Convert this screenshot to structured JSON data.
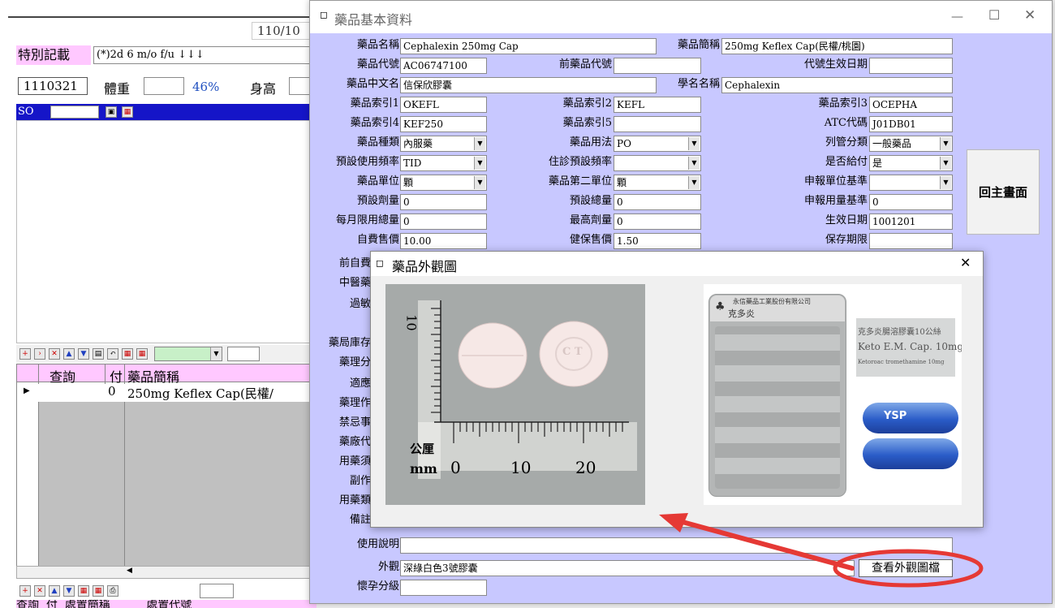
{
  "background_app": {
    "date_text": "110/10",
    "special_note_label": "特別記載",
    "special_note_value": "(*)2d 6 m/o f/u  ↓↓↓",
    "visit_date": "1110321",
    "weight_label": "體重",
    "percent_text": "46%",
    "height_label": "身高",
    "so_label": "SO",
    "grid": {
      "col_query": "查詢",
      "col_pay": "付",
      "col_name": "藥品簡稱",
      "row_pay": "0",
      "row_name": "250mg Keflex Cap(民權/"
    },
    "bottom_header": "查詢  付  處置簡稱          處置代號"
  },
  "drug_dialog": {
    "title": "藥品基本資料",
    "fields": {
      "drug_name_label": "藥品名稱",
      "drug_name": "Cephalexin 250mg Cap",
      "short_name_label": "藥品簡稱",
      "short_name": "250mg Keflex Cap(民權/桃園)",
      "code_label": "藥品代號",
      "code": "AC06747100",
      "prev_code_label": "前藥品代號",
      "prev_code": "",
      "code_date_label": "代號生效日期",
      "code_date": "",
      "chinese_name_label": "藥品中文名",
      "chinese_name": "信保欣膠囊",
      "generic_label": "學名名稱",
      "generic": "Cephalexin",
      "idx1_label": "藥品索引1",
      "idx1": "OKEFL",
      "idx2_label": "藥品索引2",
      "idx2": "KEFL",
      "idx3_label": "藥品索引3",
      "idx3": "OCEPHA",
      "idx4_label": "藥品索引4",
      "idx4": "KEF250",
      "idx5_label": "藥品索引5",
      "idx5": "",
      "atc_label": "ATC代碼",
      "atc": "J01DB01",
      "type_label": "藥品種類",
      "type": "內服藥",
      "usage_label": "藥品用法",
      "usage": "PO",
      "control_label": "列管分類",
      "control": "一般藥品",
      "freq_label": "預設使用頻率",
      "freq": "TID",
      "inpatient_freq_label": "住診預設頻率",
      "inpatient_freq": "",
      "payable_label": "是否給付",
      "payable": "是",
      "unit_label": "藥品單位",
      "unit": "顆",
      "unit2_label": "藥品第二單位",
      "unit2": "顆",
      "report_unit_label": "申報單位基準",
      "report_unit": "",
      "dose_label": "預設劑量",
      "dose": "0",
      "total_label": "預設總量",
      "total": "0",
      "report_amount_label": "申報用量基準",
      "report_amount": "0",
      "monthly_label": "每月限用總量",
      "monthly": "0",
      "max_dose_label": "最高劑量",
      "max_dose": "0",
      "effective_label": "生效日期",
      "effective": "1001201",
      "self_price_label": "自費售價",
      "self_price": "10.00",
      "nhi_price_label": "健保售價",
      "nhi_price": "1.50",
      "shelf_label": "保存期限",
      "shelf": ""
    },
    "partial_labels": [
      "前自費",
      "中醫藥",
      "過敏",
      "藥局庫存",
      "藥理分",
      "適應",
      "藥理作",
      "禁忌事",
      "藥廠代",
      "用藥須",
      "副作",
      "用藥類",
      "備註"
    ],
    "instructions_label": "使用說明",
    "instructions": "",
    "appearance_label": "外觀",
    "appearance": "深綠白色3號膠囊",
    "pregnancy_label": "懷孕分級",
    "pregnancy": "",
    "view_image_button": "查看外觀圖檔",
    "back_button": "回主畫面"
  },
  "image_dialog": {
    "title": "藥品外觀圖",
    "ruler_unit_cn": "公厘",
    "ruler_unit": "mm",
    "ruler_ticks": [
      "0",
      "10",
      "20"
    ],
    "ruler_top_mark": "10",
    "pill_imprint": "C T",
    "pack_company": "永信藥品工業股份有限公司",
    "pack_brand_cn": "克多炎",
    "pack_box_cn": "克多炎腸溶膠囊10公絲",
    "pack_box_en": "Keto E.M. Cap. 10mg",
    "pack_box_sub": "Ketoroac tromethamine 10mg",
    "capsule_text": "YSP"
  },
  "colors": {
    "dialog_bg": "#c8c8ff",
    "title_bg": "#ffffff",
    "annotation_red": "#e53935",
    "pink_strip": "#ffc8ff"
  }
}
